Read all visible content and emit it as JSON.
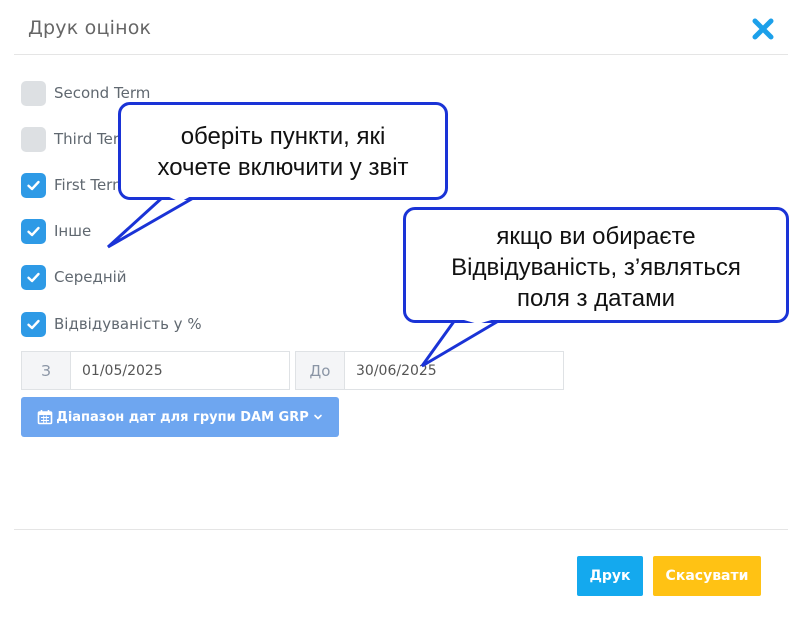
{
  "modal": {
    "title": "Друк оцінок"
  },
  "options": [
    {
      "label": "Second Term",
      "checked": false
    },
    {
      "label": "Third Term",
      "checked": false
    },
    {
      "label": "First Term",
      "checked": true
    },
    {
      "label": "Інше",
      "checked": true
    },
    {
      "label": "Середній",
      "checked": true
    },
    {
      "label": "Відвідуваність у %",
      "checked": true
    }
  ],
  "date_range": {
    "from_label": "З",
    "from_value": "01/05/2025",
    "to_label": "До",
    "to_value": "30/06/2025",
    "group_button_label": "Діапазон дат для групи DAM GRP"
  },
  "footer": {
    "print_label": "Друк",
    "cancel_label": "Скасувати"
  },
  "callouts": {
    "first": [
      "оберіть пункти, які",
      "хочете включити у звіт"
    ],
    "second": [
      "якщо ви обираєте",
      "Відвідуваність, з’являться",
      "поля з датами"
    ]
  },
  "colors": {
    "accent": "#2e9ae6",
    "close_icon": "#1ca0ea",
    "print_button": "#14a9ee",
    "cancel_button": "#ffc214",
    "range_button": "#6ea6f0",
    "callout_border": "#1a33d6"
  },
  "icons": {
    "close": "close-icon",
    "checkbox_check": "checkmark-icon",
    "calendar": "calendar-icon",
    "dropdown": "chevron-down-icon"
  }
}
